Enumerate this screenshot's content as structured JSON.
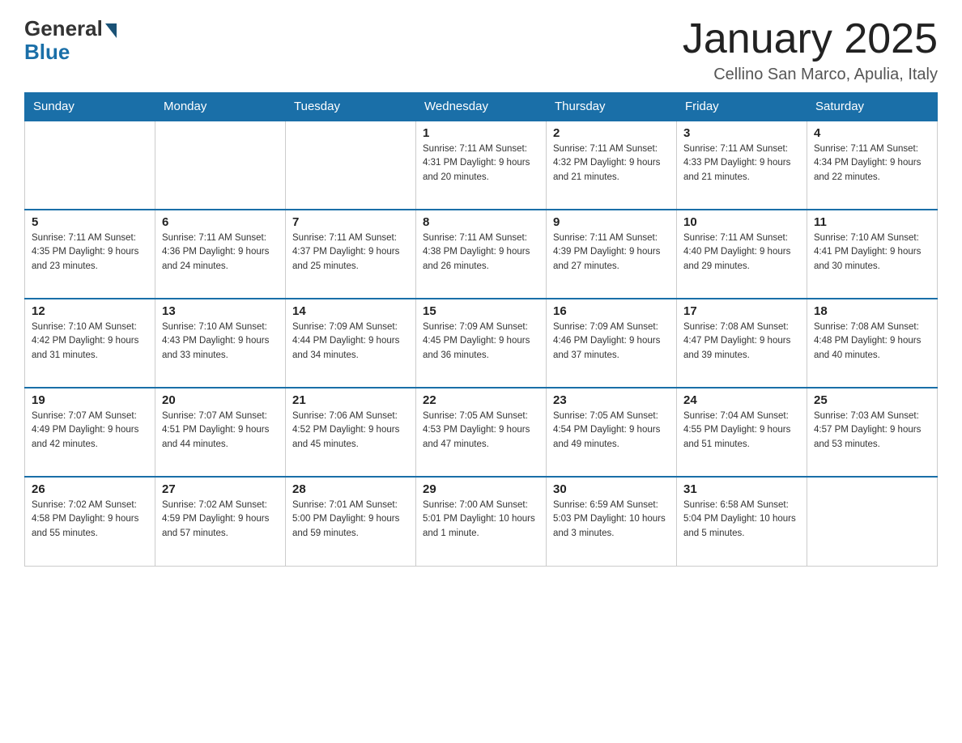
{
  "header": {
    "logo_general": "General",
    "logo_blue": "Blue",
    "month_title": "January 2025",
    "location": "Cellino San Marco, Apulia, Italy"
  },
  "days_of_week": [
    "Sunday",
    "Monday",
    "Tuesday",
    "Wednesday",
    "Thursday",
    "Friday",
    "Saturday"
  ],
  "weeks": [
    [
      {
        "day": "",
        "info": ""
      },
      {
        "day": "",
        "info": ""
      },
      {
        "day": "",
        "info": ""
      },
      {
        "day": "1",
        "info": "Sunrise: 7:11 AM\nSunset: 4:31 PM\nDaylight: 9 hours\nand 20 minutes."
      },
      {
        "day": "2",
        "info": "Sunrise: 7:11 AM\nSunset: 4:32 PM\nDaylight: 9 hours\nand 21 minutes."
      },
      {
        "day": "3",
        "info": "Sunrise: 7:11 AM\nSunset: 4:33 PM\nDaylight: 9 hours\nand 21 minutes."
      },
      {
        "day": "4",
        "info": "Sunrise: 7:11 AM\nSunset: 4:34 PM\nDaylight: 9 hours\nand 22 minutes."
      }
    ],
    [
      {
        "day": "5",
        "info": "Sunrise: 7:11 AM\nSunset: 4:35 PM\nDaylight: 9 hours\nand 23 minutes."
      },
      {
        "day": "6",
        "info": "Sunrise: 7:11 AM\nSunset: 4:36 PM\nDaylight: 9 hours\nand 24 minutes."
      },
      {
        "day": "7",
        "info": "Sunrise: 7:11 AM\nSunset: 4:37 PM\nDaylight: 9 hours\nand 25 minutes."
      },
      {
        "day": "8",
        "info": "Sunrise: 7:11 AM\nSunset: 4:38 PM\nDaylight: 9 hours\nand 26 minutes."
      },
      {
        "day": "9",
        "info": "Sunrise: 7:11 AM\nSunset: 4:39 PM\nDaylight: 9 hours\nand 27 minutes."
      },
      {
        "day": "10",
        "info": "Sunrise: 7:11 AM\nSunset: 4:40 PM\nDaylight: 9 hours\nand 29 minutes."
      },
      {
        "day": "11",
        "info": "Sunrise: 7:10 AM\nSunset: 4:41 PM\nDaylight: 9 hours\nand 30 minutes."
      }
    ],
    [
      {
        "day": "12",
        "info": "Sunrise: 7:10 AM\nSunset: 4:42 PM\nDaylight: 9 hours\nand 31 minutes."
      },
      {
        "day": "13",
        "info": "Sunrise: 7:10 AM\nSunset: 4:43 PM\nDaylight: 9 hours\nand 33 minutes."
      },
      {
        "day": "14",
        "info": "Sunrise: 7:09 AM\nSunset: 4:44 PM\nDaylight: 9 hours\nand 34 minutes."
      },
      {
        "day": "15",
        "info": "Sunrise: 7:09 AM\nSunset: 4:45 PM\nDaylight: 9 hours\nand 36 minutes."
      },
      {
        "day": "16",
        "info": "Sunrise: 7:09 AM\nSunset: 4:46 PM\nDaylight: 9 hours\nand 37 minutes."
      },
      {
        "day": "17",
        "info": "Sunrise: 7:08 AM\nSunset: 4:47 PM\nDaylight: 9 hours\nand 39 minutes."
      },
      {
        "day": "18",
        "info": "Sunrise: 7:08 AM\nSunset: 4:48 PM\nDaylight: 9 hours\nand 40 minutes."
      }
    ],
    [
      {
        "day": "19",
        "info": "Sunrise: 7:07 AM\nSunset: 4:49 PM\nDaylight: 9 hours\nand 42 minutes."
      },
      {
        "day": "20",
        "info": "Sunrise: 7:07 AM\nSunset: 4:51 PM\nDaylight: 9 hours\nand 44 minutes."
      },
      {
        "day": "21",
        "info": "Sunrise: 7:06 AM\nSunset: 4:52 PM\nDaylight: 9 hours\nand 45 minutes."
      },
      {
        "day": "22",
        "info": "Sunrise: 7:05 AM\nSunset: 4:53 PM\nDaylight: 9 hours\nand 47 minutes."
      },
      {
        "day": "23",
        "info": "Sunrise: 7:05 AM\nSunset: 4:54 PM\nDaylight: 9 hours\nand 49 minutes."
      },
      {
        "day": "24",
        "info": "Sunrise: 7:04 AM\nSunset: 4:55 PM\nDaylight: 9 hours\nand 51 minutes."
      },
      {
        "day": "25",
        "info": "Sunrise: 7:03 AM\nSunset: 4:57 PM\nDaylight: 9 hours\nand 53 minutes."
      }
    ],
    [
      {
        "day": "26",
        "info": "Sunrise: 7:02 AM\nSunset: 4:58 PM\nDaylight: 9 hours\nand 55 minutes."
      },
      {
        "day": "27",
        "info": "Sunrise: 7:02 AM\nSunset: 4:59 PM\nDaylight: 9 hours\nand 57 minutes."
      },
      {
        "day": "28",
        "info": "Sunrise: 7:01 AM\nSunset: 5:00 PM\nDaylight: 9 hours\nand 59 minutes."
      },
      {
        "day": "29",
        "info": "Sunrise: 7:00 AM\nSunset: 5:01 PM\nDaylight: 10 hours\nand 1 minute."
      },
      {
        "day": "30",
        "info": "Sunrise: 6:59 AM\nSunset: 5:03 PM\nDaylight: 10 hours\nand 3 minutes."
      },
      {
        "day": "31",
        "info": "Sunrise: 6:58 AM\nSunset: 5:04 PM\nDaylight: 10 hours\nand 5 minutes."
      },
      {
        "day": "",
        "info": ""
      }
    ]
  ]
}
